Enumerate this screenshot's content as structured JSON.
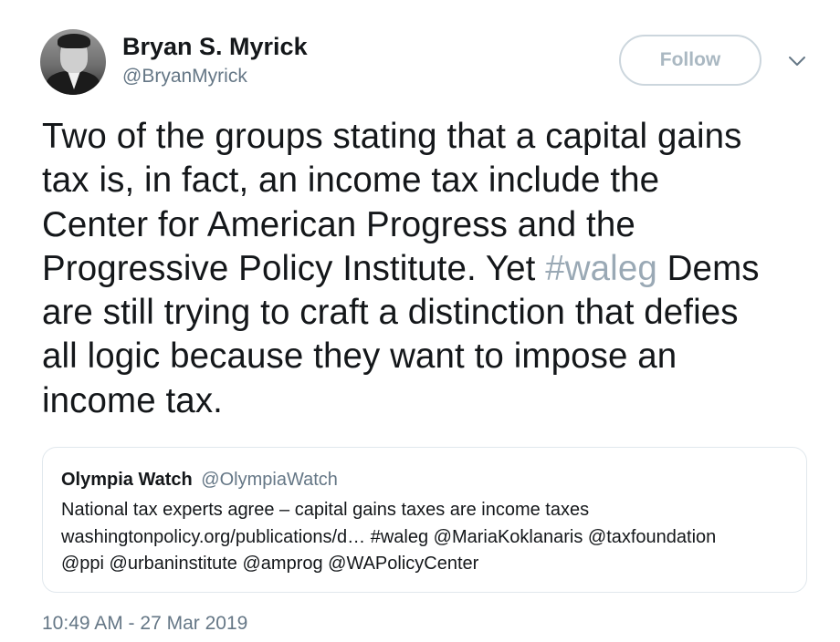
{
  "author": {
    "name": "Bryan S. Myrick",
    "handle": "@BryanMyrick"
  },
  "follow_label": "Follow",
  "tweet": {
    "lines": [
      "Two of the groups stating that a capital gains",
      "tax is, in fact, an income tax include the",
      "Center for American Progress and the"
    ],
    "line4_pre": "Progressive Policy Institute. Yet ",
    "hashtag": "#waleg",
    "line4_post": " Dems",
    "lines_after": [
      "are still trying to craft a distinction that defies",
      "all logic because they want to impose an",
      "income tax."
    ]
  },
  "quoted": {
    "name": "Olympia Watch",
    "handle": "@OlympiaWatch",
    "lines": [
      "National tax experts agree – capital gains taxes are income taxes",
      "washingtonpolicy.org/publications/d… #waleg @MariaKoklanaris @taxfoundation",
      "@ppi @urbaninstitute @amprog @WAPolicyCenter"
    ]
  },
  "timestamp": "10:49 AM - 27 Mar 2019",
  "icons": {
    "menu": "chevron-down-icon",
    "avatar": "avatar"
  },
  "colors": {
    "hashtag": "#9aa9b5",
    "secondary_text": "#657786",
    "follow_border": "#ccd6dd",
    "follow_text": "#aab8c2",
    "card_border": "#e1e8ed"
  }
}
